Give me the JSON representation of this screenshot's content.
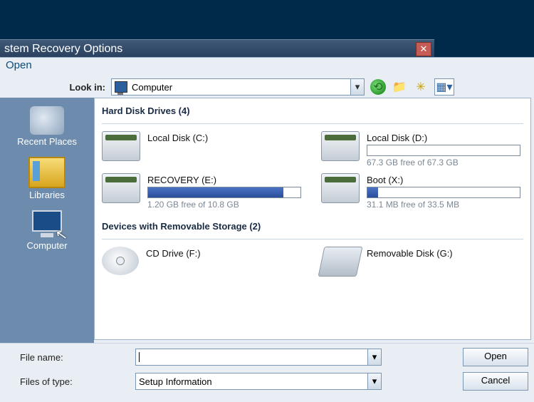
{
  "parent_window": {
    "title": "stem Recovery Options"
  },
  "dialog": {
    "title": "Open",
    "lookin_label": "Look in:",
    "lookin_value": "Computer",
    "filename_label": "File name:",
    "filename_value": "",
    "filetype_label": "Files of type:",
    "filetype_value": "Setup Information",
    "open_btn": "Open",
    "cancel_btn": "Cancel"
  },
  "places": [
    {
      "name": "Recent Places"
    },
    {
      "name": "Libraries"
    },
    {
      "name": "Computer"
    }
  ],
  "groups": [
    {
      "title": "Hard Disk Drives (4)",
      "kind": "hdd",
      "drives": [
        {
          "name": "Local Disk (C:)",
          "bar": false
        },
        {
          "name": "Local Disk (D:)",
          "bar": true,
          "used_pct": 0,
          "free_text": "67.3 GB free of 67.3 GB"
        },
        {
          "name": "RECOVERY (E:)",
          "bar": true,
          "used_pct": 89,
          "free_text": "1.20 GB free of 10.8 GB"
        },
        {
          "name": "Boot (X:)",
          "bar": true,
          "used_pct": 7,
          "free_text": "31.1 MB free of 33.5 MB"
        }
      ]
    },
    {
      "title": "Devices with Removable Storage (2)",
      "kind": "removable",
      "drives": [
        {
          "name": "CD Drive (F:)",
          "icon": "cd",
          "bar": false
        },
        {
          "name": "Removable Disk (G:)",
          "icon": "rem",
          "bar": false
        }
      ]
    }
  ]
}
